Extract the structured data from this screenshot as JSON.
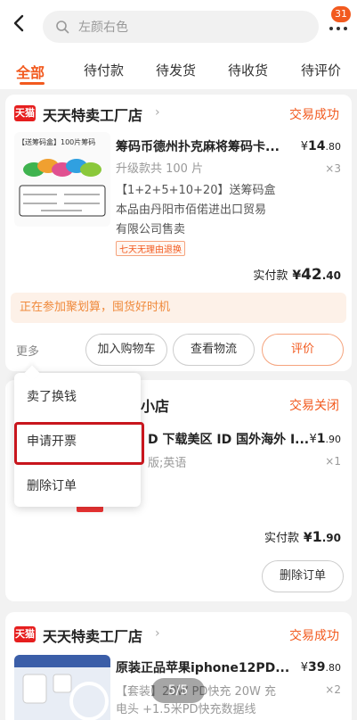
{
  "header": {
    "search_placeholder": "左颜右色",
    "badge_count": "31"
  },
  "tabs": [
    "全部",
    "待付款",
    "待发货",
    "待收货",
    "待评价"
  ],
  "orders": [
    {
      "shop_logo": "天猫",
      "shop": "天天特卖工厂店",
      "status": "交易成功",
      "thumb_title": "【送筹码盒】100片筹码",
      "product_title": "筹码币德州扑克麻将筹码卡...",
      "price_symbol": "¥",
      "price_int": "14",
      "price_dec": ".80",
      "qty": "×3",
      "spec": "升级款共 100 片",
      "desc1": "【1+2+5+10+20】送筹码盒",
      "desc2": "本品由丹阳市佰偌进出口贸易",
      "desc3": "有限公司售卖",
      "tag": "七天无理由退换",
      "total_label": "实付款",
      "total_symbol": "¥",
      "total_int": "42",
      "total_dec": ".40",
      "promo": "正在参加聚划算，囤货好时机",
      "more": "更多",
      "btn1": "加入购物车",
      "btn2": "查看物流",
      "btn3": "评价"
    },
    {
      "shop_partial": "小店",
      "status": "交易关闭",
      "product_title": "D 下载美区 ID 国外海外 I...",
      "price_symbol": "¥",
      "price_int": "1",
      "price_dec": ".90",
      "qty": "×1",
      "spec": "版;英语",
      "total_label": "实付款",
      "total_symbol": "¥",
      "total_int": "1",
      "total_dec": ".90",
      "btn1": "删除订单"
    },
    {
      "shop_logo": "天猫",
      "shop": "天天特卖工厂店",
      "status": "交易成功",
      "product_title": "原装正品苹果iphone12PD...",
      "price_symbol": "¥",
      "price_int": "39",
      "price_dec": ".80",
      "qty": "×2",
      "spec1": "【套装】20W PD快充 20W 充",
      "spec2": "电头 +1.5米PD快充数据线"
    }
  ],
  "popup": {
    "items": [
      "卖了换钱",
      "申请开票",
      "删除订单"
    ]
  },
  "pager": "5/5",
  "colors": {
    "accent": "#f25a1f",
    "highlight": "#c8161d",
    "tmall": "#e61e1e"
  }
}
